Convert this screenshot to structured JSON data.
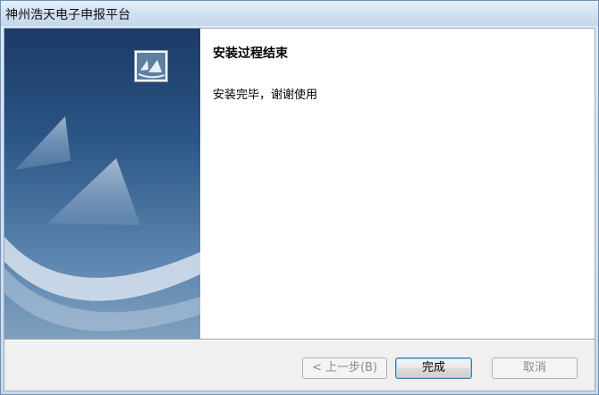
{
  "window": {
    "title": "神州浩天电子申报平台"
  },
  "page": {
    "heading": "安装过程结束",
    "message": "安装完毕，谢谢使用"
  },
  "buttons": {
    "back": "< 上一步(B)",
    "finish": "完成",
    "cancel": "取消"
  },
  "icons": {
    "logo": "sail-logo-icon",
    "banner": "sail-banner-graphic"
  },
  "colors": {
    "banner_top": "#1c3a66",
    "banner_bottom": "#7f9fbe",
    "title_bar": "#d4e2f2"
  }
}
